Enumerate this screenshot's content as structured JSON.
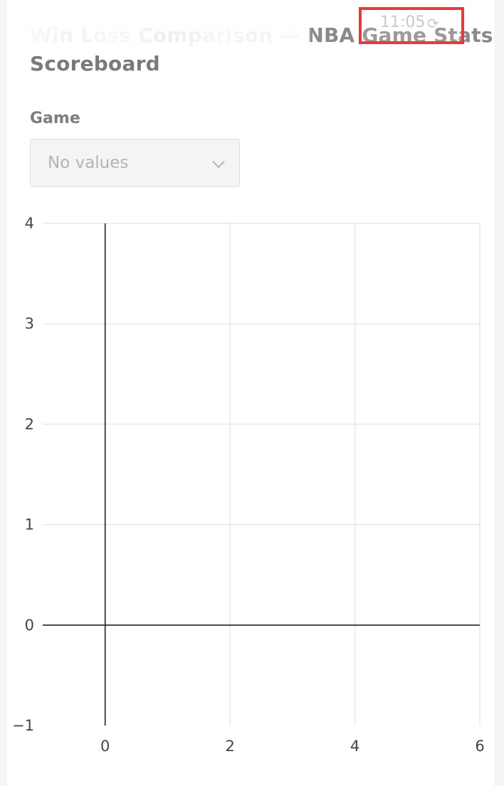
{
  "header": {
    "title_line1": "Win Loss Comparison — NBA Game Stats",
    "title_line2": "Scoreboard",
    "time": "11:05"
  },
  "filters": {
    "game_label": "Game",
    "game_value": "No values"
  },
  "icons": {
    "refresh": "refresh-icon",
    "chevron": "chevron-down-icon"
  },
  "chart_data": {
    "type": "scatter",
    "series": [],
    "title": "",
    "xlabel": "",
    "ylabel": "",
    "xlim": [
      -1,
      6
    ],
    "ylim": [
      -1,
      4
    ],
    "x_ticks": [
      "0",
      "2",
      "4",
      "6"
    ],
    "y_ticks": [
      "4",
      "3",
      "2",
      "1",
      "0",
      "−1"
    ],
    "grid": true,
    "colors": {
      "grid": "#e8e8e8",
      "axis": "#222222",
      "text": "#444444"
    }
  }
}
